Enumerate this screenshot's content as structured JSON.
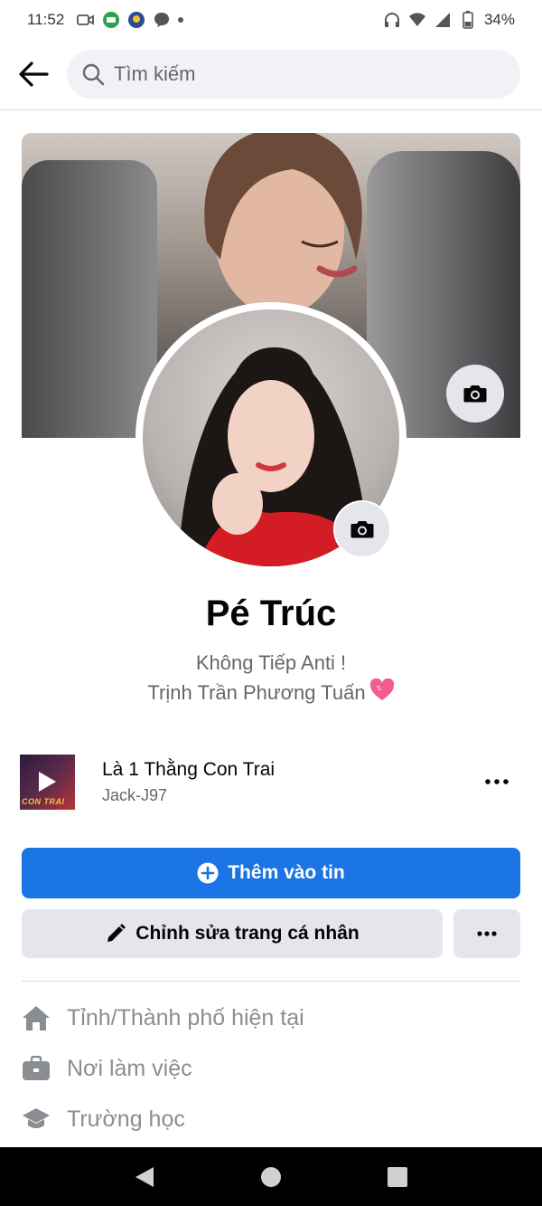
{
  "status_bar": {
    "time": "11:52",
    "battery": "34%"
  },
  "search": {
    "placeholder": "Tìm kiếm"
  },
  "profile": {
    "name": "Pé Trúc",
    "bio_line1": "Không Tiếp Anti !",
    "bio_line2": "Trịnh Trần Phương Tuấn"
  },
  "music": {
    "title": "Là 1 Thằng Con Trai",
    "artist": "Jack-J97",
    "thumb_text": "CON TRAI"
  },
  "buttons": {
    "add_to_story": "Thêm vào tin",
    "edit_profile": "Chỉnh sửa trang cá nhân"
  },
  "info": {
    "city": "Tỉnh/Thành phố hiện tại",
    "work": "Nơi làm việc",
    "school": "Trường học"
  },
  "colors": {
    "primary": "#1b74e4",
    "secondary_bg": "#e4e6eb",
    "muted_text": "#65676b"
  }
}
